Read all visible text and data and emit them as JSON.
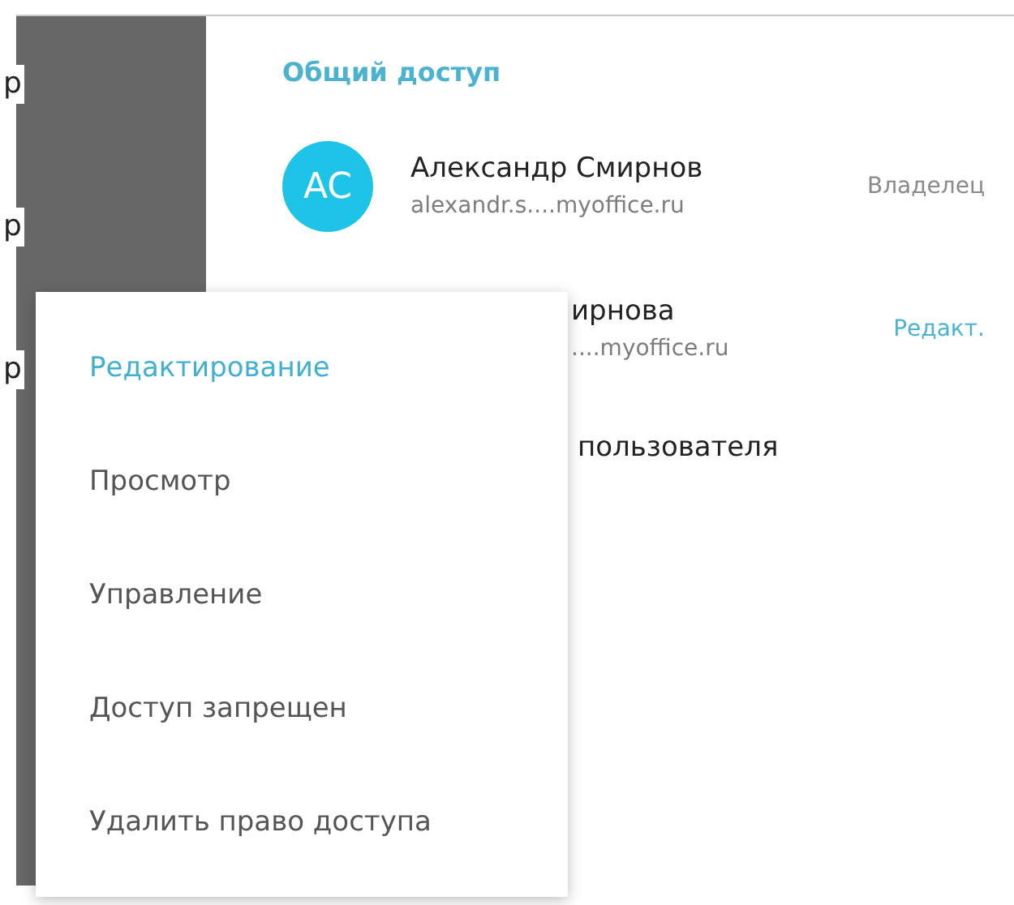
{
  "sidebar": {
    "items": [
      "р",
      "р",
      "р"
    ]
  },
  "sharing": {
    "title": "Общий доступ",
    "users": [
      {
        "initials": "AC",
        "name": "Александр Смирнов",
        "email": "alexandr.s....myoffice.ru",
        "role": "Владелец",
        "role_editable": false
      },
      {
        "name": "ирнова",
        "email": "....myoffice.ru",
        "role": "Редакт.",
        "role_editable": true
      }
    ],
    "add_user": "пользователя"
  },
  "menu": {
    "items": [
      {
        "label": "Редактирование",
        "selected": true
      },
      {
        "label": "Просмотр",
        "selected": false
      },
      {
        "label": "Управление",
        "selected": false
      },
      {
        "label": "Доступ запрещен",
        "selected": false
      },
      {
        "label": "Удалить право доступа",
        "selected": false
      }
    ]
  }
}
